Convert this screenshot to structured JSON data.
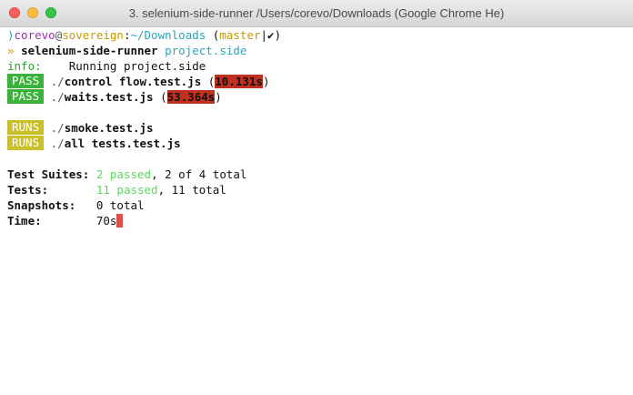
{
  "window": {
    "title": "3. selenium-side-runner  /Users/corevo/Downloads (Google Chrome He)"
  },
  "prompt": {
    "marker": ")",
    "user": "corevo",
    "at": "@",
    "host": "sovereign",
    "colon": ":",
    "path": "~/Downloads",
    "branch_open": " (",
    "branch": "master",
    "branch_sep": "|",
    "branch_status": "✔",
    "branch_close": ")"
  },
  "command": {
    "arrow": "»",
    "name": "selenium-side-runner",
    "arg": "project.side"
  },
  "info": {
    "label": "info:",
    "message": "    Running project.side"
  },
  "tests": [
    {
      "status": "PASS",
      "dir": "./",
      "file": "control flow.test.js",
      "open": " (",
      "time": "10.131s",
      "close": ")"
    },
    {
      "status": "PASS",
      "dir": "./",
      "file": "waits.test.js",
      "open": " (",
      "time": "53.364s",
      "close": ")"
    }
  ],
  "running": [
    {
      "status": "RUNS",
      "dir": "./",
      "file": "smoke.test.js"
    },
    {
      "status": "RUNS",
      "dir": "./",
      "file": "all tests.test.js"
    }
  ],
  "summary": {
    "suites_label": "Test Suites:",
    "suites_passed": "2 passed",
    "suites_rest": ", 2 of 4 total",
    "tests_label": "Tests:",
    "tests_passed": "11 passed",
    "tests_rest": ", 11 total",
    "snapshots_label": "Snapshots:",
    "snapshots_value": "0 total",
    "time_label": "Time:",
    "time_value": "70s"
  },
  "colors": {
    "pass_badge": "#3cb23c",
    "runs_badge": "#c9c02b",
    "time_highlight": "#c0301e",
    "cursor": "#e0504a"
  }
}
